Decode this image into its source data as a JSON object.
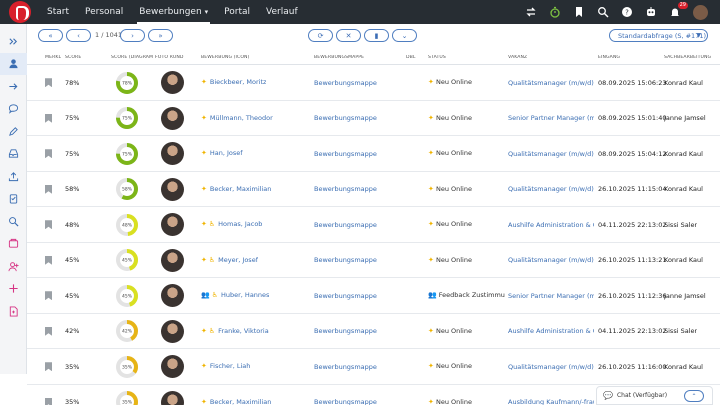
{
  "nav": {
    "items": [
      {
        "label": "Start",
        "active": false
      },
      {
        "label": "Personal",
        "active": false
      },
      {
        "label": "Bewerbungen",
        "active": true
      },
      {
        "label": "Portal",
        "active": false
      },
      {
        "label": "Verlauf",
        "active": false
      }
    ],
    "notification_count": "29"
  },
  "sidebar_icons": [
    "expand-icon",
    "user-icon",
    "arrow-right-icon",
    "chat-icon",
    "edit-icon",
    "inbox-icon",
    "upload-icon",
    "clipboard-icon",
    "search-icon",
    "forms-icon",
    "add-user-icon",
    "plus-icon",
    "document-icon"
  ],
  "toolbar": {
    "pager": "1 / 1041",
    "filter_label": "Standardabfrage (S, #171)"
  },
  "columns": {
    "merkl": "MERKL",
    "score": "SCORE",
    "score_chart": "SCORE (DIAGRAMM)",
    "foto": "FOTO RUND",
    "bewerbung": "BEWERBUNG (ICON)",
    "mappe": "BEWERBUNGSMAPPE",
    "dbl": "DBL",
    "status": "STATUS",
    "vakanz": "VAKANZ",
    "eingang": "EINGANG",
    "sachbearbeitung": "SACHBEARBEITUNG"
  },
  "rows": [
    {
      "score": "78%",
      "pct": 78,
      "name": "Bieckbeer, Moritz",
      "icons": [
        "spark"
      ],
      "mappe": "Bewerbungsmappe",
      "status_icon": "spark",
      "status": "Neu Online",
      "vakanz": "Qualitätsmanager (m/w/d)",
      "eingang": "08.09.2025 15:06:23",
      "sb": "Konrad Kaul"
    },
    {
      "score": "75%",
      "pct": 75,
      "name": "Müllmann, Theodor",
      "icons": [
        "spark"
      ],
      "mappe": "Bewerbungsmappe",
      "status_icon": "spark",
      "status": "Neu Online",
      "vakanz": "Senior Partner Manager (m/w/d)",
      "eingang": "08.09.2025 15:01:40",
      "sb": "Janne Jamsel"
    },
    {
      "score": "75%",
      "pct": 75,
      "name": "Han, Josef",
      "icons": [
        "spark"
      ],
      "mappe": "Bewerbungsmappe",
      "status_icon": "spark",
      "status": "Neu Online",
      "vakanz": "Qualitätsmanager (m/w/d)",
      "eingang": "08.09.2025 15:04:12",
      "sb": "Konrad Kaul"
    },
    {
      "score": "58%",
      "pct": 58,
      "name": "Becker, Maximilian",
      "icons": [
        "spark"
      ],
      "mappe": "Bewerbungsmappe",
      "status_icon": "spark",
      "status": "Neu Online",
      "vakanz": "Qualitätsmanager (m/w/d)",
      "eingang": "26.10.2025 11:15:04",
      "sb": "Konrad Kaul"
    },
    {
      "score": "48%",
      "pct": 48,
      "name": "Homas, Jacob",
      "icons": [
        "spark",
        "wheel"
      ],
      "mappe": "Bewerbungsmappe",
      "status_icon": "spark",
      "status": "Neu Online",
      "vakanz": "Aushilfe Administration & Offi",
      "eingang": "04.11.2025 22:13:02",
      "sb": "Sissi Saler"
    },
    {
      "score": "45%",
      "pct": 45,
      "name": "Meyer, Josef",
      "icons": [
        "spark",
        "wheel"
      ],
      "mappe": "Bewerbungsmappe",
      "status_icon": "spark",
      "status": "Neu Online",
      "vakanz": "Qualitätsmanager (m/w/d)",
      "eingang": "26.10.2025 11:13:21",
      "sb": "Konrad Kaul"
    },
    {
      "score": "45%",
      "pct": 45,
      "name": "Huber, Hannes",
      "icons": [
        "group",
        "wheel"
      ],
      "mappe": "Bewerbungsmappe",
      "status_icon": "group",
      "status": "Feedback Zustimmung",
      "vakanz": "Senior Partner Manager (m/w/d)",
      "eingang": "26.10.2025 11:12:36",
      "sb": "Janne Jamsel"
    },
    {
      "score": "42%",
      "pct": 42,
      "name": "Franke, Viktoria",
      "icons": [
        "spark",
        "wheel"
      ],
      "mappe": "Bewerbungsmappe",
      "status_icon": "spark",
      "status": "Neu Online",
      "vakanz": "Aushilfe Administration & Offi",
      "eingang": "04.11.2025 22:13:02",
      "sb": "Sissi Saler"
    },
    {
      "score": "35%",
      "pct": 35,
      "name": "Fischer, Liah",
      "icons": [
        "spark"
      ],
      "mappe": "Bewerbungsmappe",
      "status_icon": "spark",
      "status": "Neu Online",
      "vakanz": "Qualitätsmanager (m/w/d)",
      "eingang": "26.10.2025 11:16:00",
      "sb": "Konrad Kaul"
    },
    {
      "score": "35%",
      "pct": 35,
      "name": "Becker, Maximilian",
      "icons": [
        "spark"
      ],
      "mappe": "Bewerbungsmappe",
      "status_icon": "spark",
      "status": "Neu Online",
      "vakanz": "Ausbildung Kaufmann/-frau f",
      "eingang": "04.11.2025 22:13:02",
      "sb": "Sissi Saler"
    }
  ],
  "chat": {
    "label": "Chat (Verfügbar)"
  },
  "colors": {
    "high": "#7cb518",
    "mid": "#d9e021",
    "low": "#e7b416",
    "track": "#e3e3e3",
    "accent": "#3a6db2",
    "nav_bg": "#272d33"
  }
}
